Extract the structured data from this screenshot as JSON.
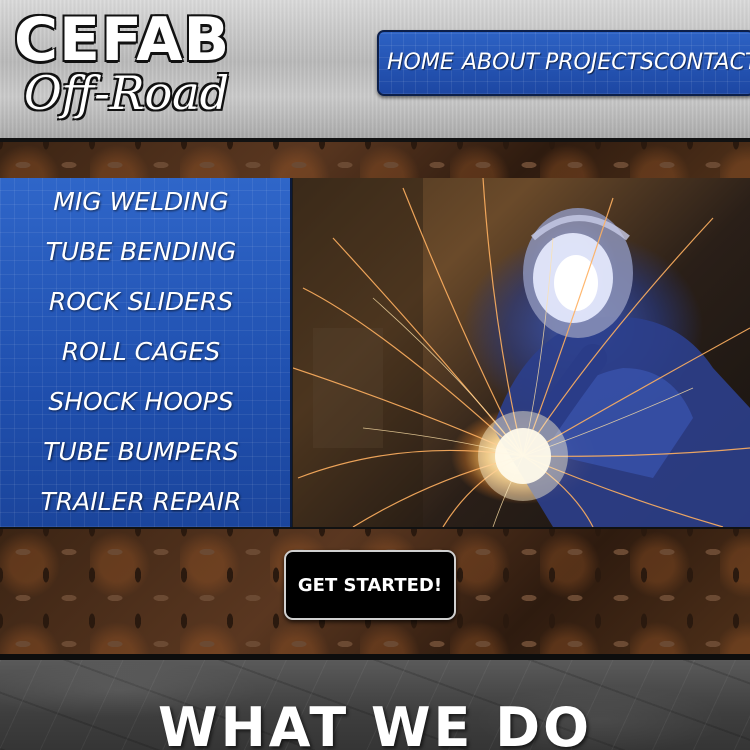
{
  "header": {
    "logo_main": "CEFAB",
    "logo_sub": "Off-Road"
  },
  "nav": {
    "items": [
      {
        "label": "HOME"
      },
      {
        "label": "ABOUT"
      },
      {
        "label": "PROJECTS"
      },
      {
        "label": "CONTACT"
      }
    ]
  },
  "services": {
    "items": [
      {
        "label": "MIG WELDING"
      },
      {
        "label": "TUBE BENDING"
      },
      {
        "label": "ROCK SLIDERS"
      },
      {
        "label": "ROLL CAGES"
      },
      {
        "label": "SHOCK HOOPS"
      },
      {
        "label": "TUBE BUMPERS"
      },
      {
        "label": "TRAILER REPAIR"
      }
    ]
  },
  "hero": {
    "image": "welder-sparks-photo"
  },
  "cta": {
    "label": "GET STARTED!"
  },
  "section": {
    "title": "WHAT WE DO"
  },
  "colors": {
    "nav_blue": "#2d62c4",
    "cta_black": "#000000"
  }
}
